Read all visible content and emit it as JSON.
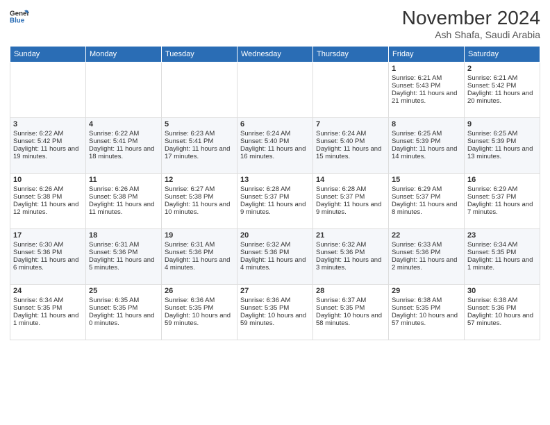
{
  "header": {
    "logo_general": "General",
    "logo_blue": "Blue",
    "title": "November 2024",
    "subtitle": "Ash Shafa, Saudi Arabia"
  },
  "days_of_week": [
    "Sunday",
    "Monday",
    "Tuesday",
    "Wednesday",
    "Thursday",
    "Friday",
    "Saturday"
  ],
  "weeks": [
    {
      "days": [
        {
          "num": "",
          "content": ""
        },
        {
          "num": "",
          "content": ""
        },
        {
          "num": "",
          "content": ""
        },
        {
          "num": "",
          "content": ""
        },
        {
          "num": "",
          "content": ""
        },
        {
          "num": "1",
          "content": "Sunrise: 6:21 AM\nSunset: 5:43 PM\nDaylight: 11 hours and 21 minutes."
        },
        {
          "num": "2",
          "content": "Sunrise: 6:21 AM\nSunset: 5:42 PM\nDaylight: 11 hours and 20 minutes."
        }
      ]
    },
    {
      "days": [
        {
          "num": "3",
          "content": "Sunrise: 6:22 AM\nSunset: 5:42 PM\nDaylight: 11 hours and 19 minutes."
        },
        {
          "num": "4",
          "content": "Sunrise: 6:22 AM\nSunset: 5:41 PM\nDaylight: 11 hours and 18 minutes."
        },
        {
          "num": "5",
          "content": "Sunrise: 6:23 AM\nSunset: 5:41 PM\nDaylight: 11 hours and 17 minutes."
        },
        {
          "num": "6",
          "content": "Sunrise: 6:24 AM\nSunset: 5:40 PM\nDaylight: 11 hours and 16 minutes."
        },
        {
          "num": "7",
          "content": "Sunrise: 6:24 AM\nSunset: 5:40 PM\nDaylight: 11 hours and 15 minutes."
        },
        {
          "num": "8",
          "content": "Sunrise: 6:25 AM\nSunset: 5:39 PM\nDaylight: 11 hours and 14 minutes."
        },
        {
          "num": "9",
          "content": "Sunrise: 6:25 AM\nSunset: 5:39 PM\nDaylight: 11 hours and 13 minutes."
        }
      ]
    },
    {
      "days": [
        {
          "num": "10",
          "content": "Sunrise: 6:26 AM\nSunset: 5:38 PM\nDaylight: 11 hours and 12 minutes."
        },
        {
          "num": "11",
          "content": "Sunrise: 6:26 AM\nSunset: 5:38 PM\nDaylight: 11 hours and 11 minutes."
        },
        {
          "num": "12",
          "content": "Sunrise: 6:27 AM\nSunset: 5:38 PM\nDaylight: 11 hours and 10 minutes."
        },
        {
          "num": "13",
          "content": "Sunrise: 6:28 AM\nSunset: 5:37 PM\nDaylight: 11 hours and 9 minutes."
        },
        {
          "num": "14",
          "content": "Sunrise: 6:28 AM\nSunset: 5:37 PM\nDaylight: 11 hours and 9 minutes."
        },
        {
          "num": "15",
          "content": "Sunrise: 6:29 AM\nSunset: 5:37 PM\nDaylight: 11 hours and 8 minutes."
        },
        {
          "num": "16",
          "content": "Sunrise: 6:29 AM\nSunset: 5:37 PM\nDaylight: 11 hours and 7 minutes."
        }
      ]
    },
    {
      "days": [
        {
          "num": "17",
          "content": "Sunrise: 6:30 AM\nSunset: 5:36 PM\nDaylight: 11 hours and 6 minutes."
        },
        {
          "num": "18",
          "content": "Sunrise: 6:31 AM\nSunset: 5:36 PM\nDaylight: 11 hours and 5 minutes."
        },
        {
          "num": "19",
          "content": "Sunrise: 6:31 AM\nSunset: 5:36 PM\nDaylight: 11 hours and 4 minutes."
        },
        {
          "num": "20",
          "content": "Sunrise: 6:32 AM\nSunset: 5:36 PM\nDaylight: 11 hours and 4 minutes."
        },
        {
          "num": "21",
          "content": "Sunrise: 6:32 AM\nSunset: 5:36 PM\nDaylight: 11 hours and 3 minutes."
        },
        {
          "num": "22",
          "content": "Sunrise: 6:33 AM\nSunset: 5:36 PM\nDaylight: 11 hours and 2 minutes."
        },
        {
          "num": "23",
          "content": "Sunrise: 6:34 AM\nSunset: 5:35 PM\nDaylight: 11 hours and 1 minute."
        }
      ]
    },
    {
      "days": [
        {
          "num": "24",
          "content": "Sunrise: 6:34 AM\nSunset: 5:35 PM\nDaylight: 11 hours and 1 minute."
        },
        {
          "num": "25",
          "content": "Sunrise: 6:35 AM\nSunset: 5:35 PM\nDaylight: 11 hours and 0 minutes."
        },
        {
          "num": "26",
          "content": "Sunrise: 6:36 AM\nSunset: 5:35 PM\nDaylight: 10 hours and 59 minutes."
        },
        {
          "num": "27",
          "content": "Sunrise: 6:36 AM\nSunset: 5:35 PM\nDaylight: 10 hours and 59 minutes."
        },
        {
          "num": "28",
          "content": "Sunrise: 6:37 AM\nSunset: 5:35 PM\nDaylight: 10 hours and 58 minutes."
        },
        {
          "num": "29",
          "content": "Sunrise: 6:38 AM\nSunset: 5:35 PM\nDaylight: 10 hours and 57 minutes."
        },
        {
          "num": "30",
          "content": "Sunrise: 6:38 AM\nSunset: 5:36 PM\nDaylight: 10 hours and 57 minutes."
        }
      ]
    }
  ]
}
